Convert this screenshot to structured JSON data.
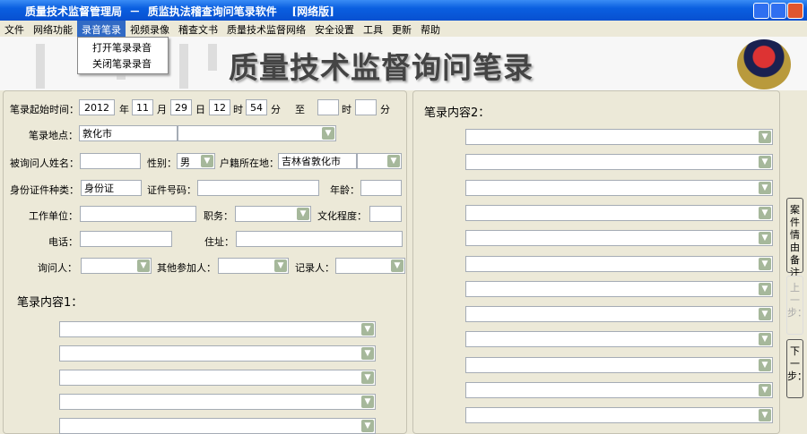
{
  "window": {
    "title": "质量技术监督管理局  －  质监执法稽查询问笔录软件    [网络版]"
  },
  "menu": [
    "文件",
    "网络功能",
    "录音笔录",
    "视频录像",
    "稽查文书",
    "质量技术监督网络",
    "安全设置",
    "工具",
    "更新",
    "帮助"
  ],
  "dropdown": [
    "打开笔录录音",
    "关闭笔录录音"
  ],
  "banner": {
    "title": "质量技术监督询问笔录"
  },
  "form": {
    "start_time_label": "笔录起始时间：",
    "year": "2012",
    "year_unit": "年",
    "month": "11",
    "month_unit": "月",
    "day": "29",
    "day_unit": "日",
    "hour": "12",
    "hour_unit": "时",
    "minute": "54",
    "minute_unit": "分",
    "to": "至",
    "end_hour": "",
    "end_hour_unit": "时",
    "end_minute": "",
    "end_minute_unit": "分",
    "place_label": "笔录地点：",
    "place": "敦化市",
    "name_label": "被询问人姓名：",
    "gender_label": "性别：",
    "gender": "男",
    "domicile_label": "户籍所在地：",
    "domicile": "吉林省敦化市",
    "id_type_label": "身份证件种类：",
    "id_type": "身份证",
    "id_no_label": "证件号码：",
    "age_label": "年龄：",
    "work_label": "工作单位：",
    "position_label": "职务：",
    "education_label": "文化程度：",
    "phone_label": "电话：",
    "address_label": "住址：",
    "interviewer_label": "询问人：",
    "others_label": "其他参加人：",
    "recorder_label": "记录人："
  },
  "content1_label": "笔录内容1：",
  "content2_label": "笔录内容2：",
  "side": {
    "notes": "案件情由备注",
    "prev": "上一步：",
    "next": "下一步："
  }
}
